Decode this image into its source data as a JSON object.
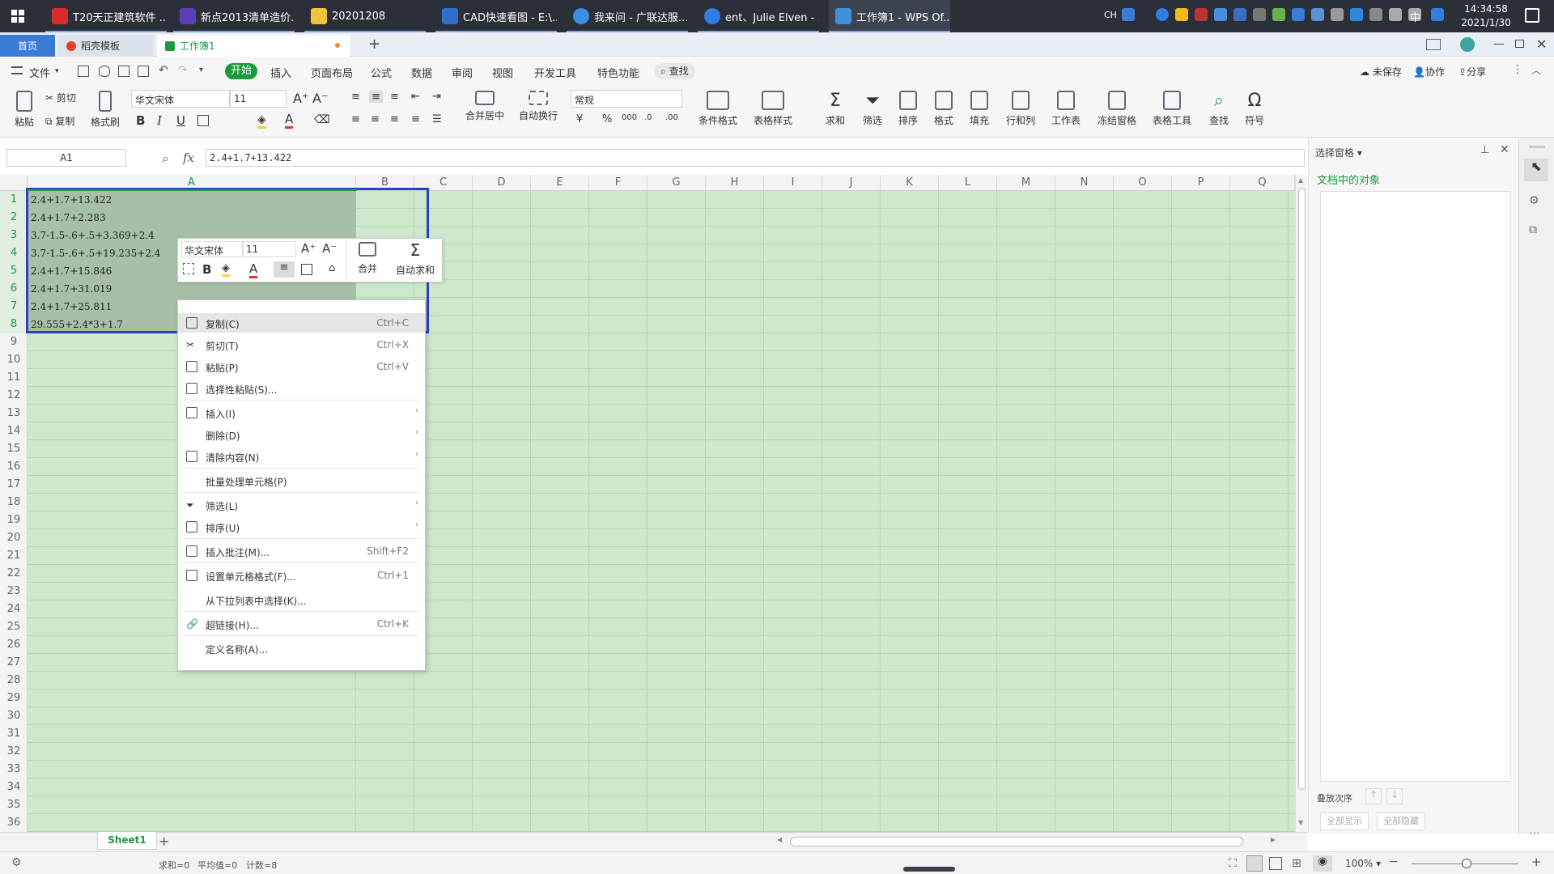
{
  "taskbar": {
    "items": [
      {
        "label": "T20天正建筑软件 ...",
        "color": "#d92b2b"
      },
      {
        "label": "新点2013清单造价...",
        "color": "#5a3fb8"
      },
      {
        "label": "20201208",
        "color": "#f2c23d"
      },
      {
        "label": "CAD快速看图 - E:\\...",
        "color": "#2d6fc9"
      },
      {
        "label": "我来问 - 广联达服...",
        "color": "#3a8ee6"
      },
      {
        "label": "ent、Julie Elven - ...",
        "color": "#2f7de1"
      },
      {
        "label": "工作簿1 - WPS Of...",
        "color": "#3c8fd8"
      }
    ],
    "lang": "CH",
    "ime": "中",
    "time": "14:34:58",
    "date": "2021/1/30"
  },
  "tabs": {
    "home": "首页",
    "template": "稻壳模板",
    "workbook": "工作簿1",
    "add": "+"
  },
  "menu": {
    "file": "文件",
    "items": [
      "开始",
      "插入",
      "页面布局",
      "公式",
      "数据",
      "审阅",
      "视图",
      "开发工具",
      "特色功能"
    ],
    "search": "查找",
    "unsaved": "未保存",
    "collab": "协作",
    "share": "分享"
  },
  "ribbon": {
    "paste": "粘贴",
    "cut": "剪切",
    "copy": "复制",
    "format_painter": "格式刷",
    "font_name": "华文宋体",
    "font_size": "11",
    "merge": "合并居中",
    "wrap": "自动换行",
    "number_format": "常规",
    "cond_format": "条件格式",
    "table_style": "表格样式",
    "sum": "求和",
    "filter": "筛选",
    "sort": "排序",
    "format": "格式",
    "fill": "填充",
    "row_col": "行和列",
    "worksheet": "工作表",
    "freeze": "冻结窗格",
    "table_tools": "表格工具",
    "find": "查找",
    "symbol": "符号"
  },
  "formula": {
    "name_box": "A1",
    "fx": "fx",
    "content": "2.4+1.7+13.422"
  },
  "grid": {
    "columns": [
      "A",
      "B",
      "C",
      "D",
      "E",
      "F",
      "G",
      "H",
      "I",
      "J",
      "K",
      "L",
      "M",
      "N",
      "O",
      "P",
      "Q"
    ],
    "rows": [
      "1",
      "2",
      "3",
      "4",
      "5",
      "6",
      "7",
      "8",
      "9",
      "10",
      "11",
      "12",
      "13",
      "14",
      "15",
      "16",
      "17",
      "18",
      "19",
      "20",
      "21",
      "22",
      "23",
      "24",
      "25",
      "26",
      "27",
      "28",
      "29",
      "30",
      "31",
      "32",
      "33",
      "34",
      "35",
      "36"
    ],
    "cells": [
      "2.4+1.7+13.422",
      "2.4+1.7+2.283",
      "3.7-1.5-.6+.5+3.369+2.4",
      "3.7-1.5-.6+.5+19.235+2.4",
      "2.4+1.7+15.846",
      "2.4+1.7+31.019",
      "2.4+1.7+25.811",
      "29.555+2.4*3+1.7"
    ]
  },
  "mini_toolbar": {
    "font_name": "华文宋体",
    "font_size": "11",
    "merge": "合并",
    "autosum": "自动求和"
  },
  "context_menu": {
    "items": [
      {
        "label": "复制(C)",
        "shortcut": "Ctrl+C"
      },
      {
        "label": "剪切(T)",
        "shortcut": "Ctrl+X"
      },
      {
        "label": "粘贴(P)",
        "shortcut": "Ctrl+V"
      },
      {
        "label": "选择性粘贴(S)...",
        "shortcut": ""
      },
      {
        "label": "插入(I)",
        "shortcut": ""
      },
      {
        "label": "删除(D)",
        "shortcut": ""
      },
      {
        "label": "清除内容(N)",
        "shortcut": ""
      },
      {
        "label": "批量处理单元格(P)",
        "shortcut": ""
      },
      {
        "label": "筛选(L)",
        "shortcut": ""
      },
      {
        "label": "排序(U)",
        "shortcut": ""
      },
      {
        "label": "插入批注(M)...",
        "shortcut": "Shift+F2"
      },
      {
        "label": "设置单元格格式(F)...",
        "shortcut": "Ctrl+1"
      },
      {
        "label": "从下拉列表中选择(K)...",
        "shortcut": ""
      },
      {
        "label": "超链接(H)...",
        "shortcut": "Ctrl+K"
      },
      {
        "label": "定义名称(A)...",
        "shortcut": ""
      }
    ]
  },
  "pane": {
    "title": "选择窗格",
    "subtitle": "文档中的对象",
    "order": "叠放次序",
    "show_all": "全部显示",
    "hide_all": "全部隐藏"
  },
  "sheets": {
    "active": "Sheet1",
    "add": "+"
  },
  "status": {
    "sum": "求和=0",
    "avg": "平均值=0",
    "count": "计数=8",
    "zoom": "100%"
  },
  "colors": {
    "accent": "#1a9b3e",
    "selection_border": "#2f3fbf",
    "cell_bg": "#cde8cd"
  }
}
